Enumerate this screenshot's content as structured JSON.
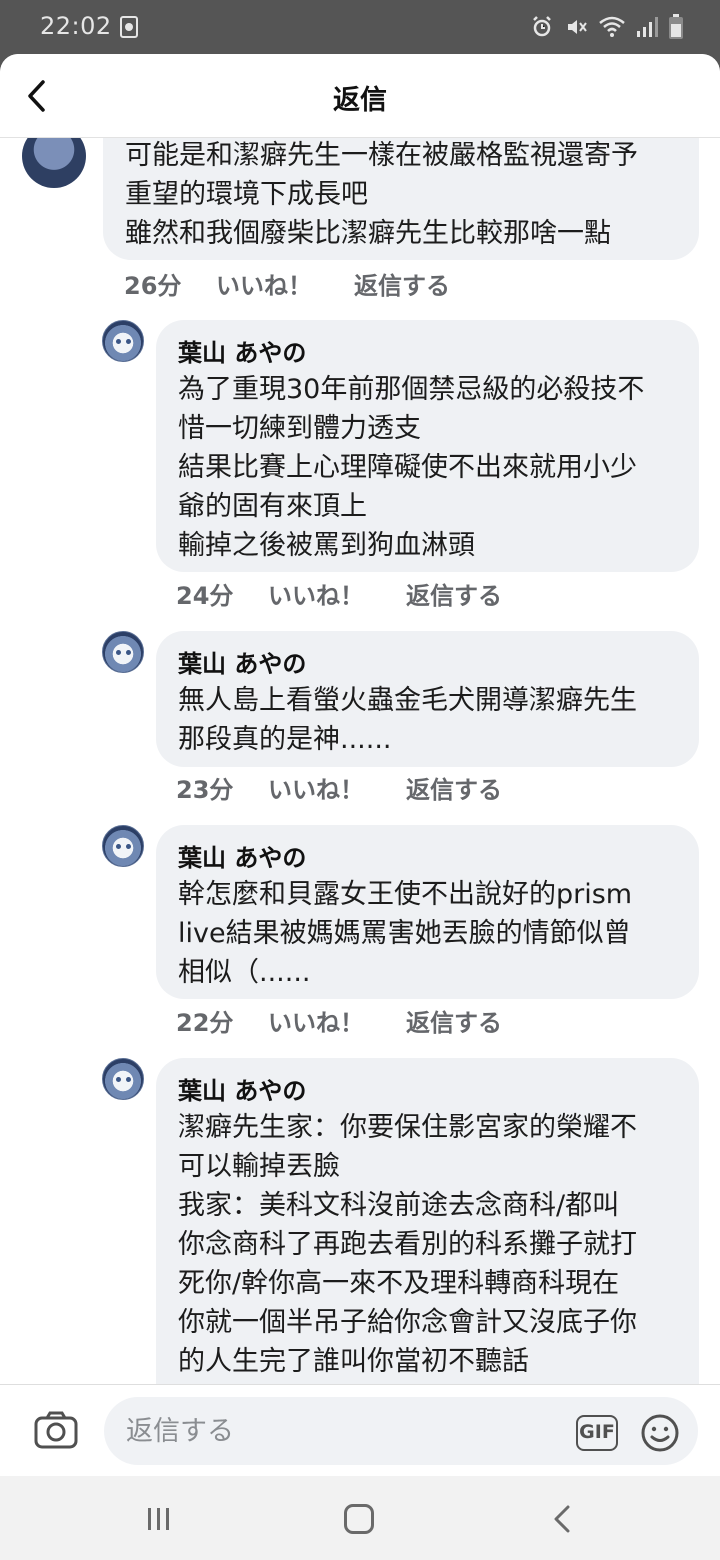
{
  "status_bar": {
    "time": "22:02"
  },
  "header": {
    "title": "返信"
  },
  "top_comment": {
    "lines": [
      "可能是和潔癖先生一樣在被嚴格監視還寄予",
      "重望的環境下成長吧",
      "雖然和我個廢柴比潔癖先生比較那啥一點"
    ],
    "time": "26分",
    "like_label": "いいね！",
    "reply_label": "返信する"
  },
  "replies": [
    {
      "author": "葉山 あやの",
      "lines": [
        "為了重現30年前那個禁忌級的必殺技不",
        "惜一切練到體力透支",
        "結果比賽上心理障礙使不出來就用小少",
        "爺的固有來頂上",
        "輸掉之後被罵到狗血淋頭"
      ],
      "time": "24分",
      "like_label": "いいね！",
      "reply_label": "返信する"
    },
    {
      "author": "葉山 あやの",
      "lines": [
        "無人島上看螢火蟲金毛犬開導潔癖先生",
        "那段真的是神......"
      ],
      "time": "23分",
      "like_label": "いいね！",
      "reply_label": "返信する"
    },
    {
      "author": "葉山 あやの",
      "lines": [
        "幹怎麼和貝露女王使不出說好的prism",
        "live結果被媽媽罵害她丟臉的情節似曾",
        "相似（......"
      ],
      "time": "22分",
      "like_label": "いいね！",
      "reply_label": "返信する"
    },
    {
      "author": "葉山 あやの",
      "lines": [
        "潔癖先生家：你要保住影宮家的榮耀不",
        "可以輸掉丟臉",
        "我家：美科文科沒前途去念商科/都叫",
        "你念商科了再跑去看別的科系攤子就打",
        "死你/幹你高一來不及理科轉商科現在",
        "你就一個半吊子給你念會計又沒底子你",
        "的人生完了誰叫你當初不聽話"
      ]
    }
  ],
  "input": {
    "placeholder": "返信する",
    "gif_label": "GIF"
  },
  "colors": {
    "bubble": "#eff1f4",
    "meta_text": "#65676b",
    "status_bar": "#555555"
  }
}
